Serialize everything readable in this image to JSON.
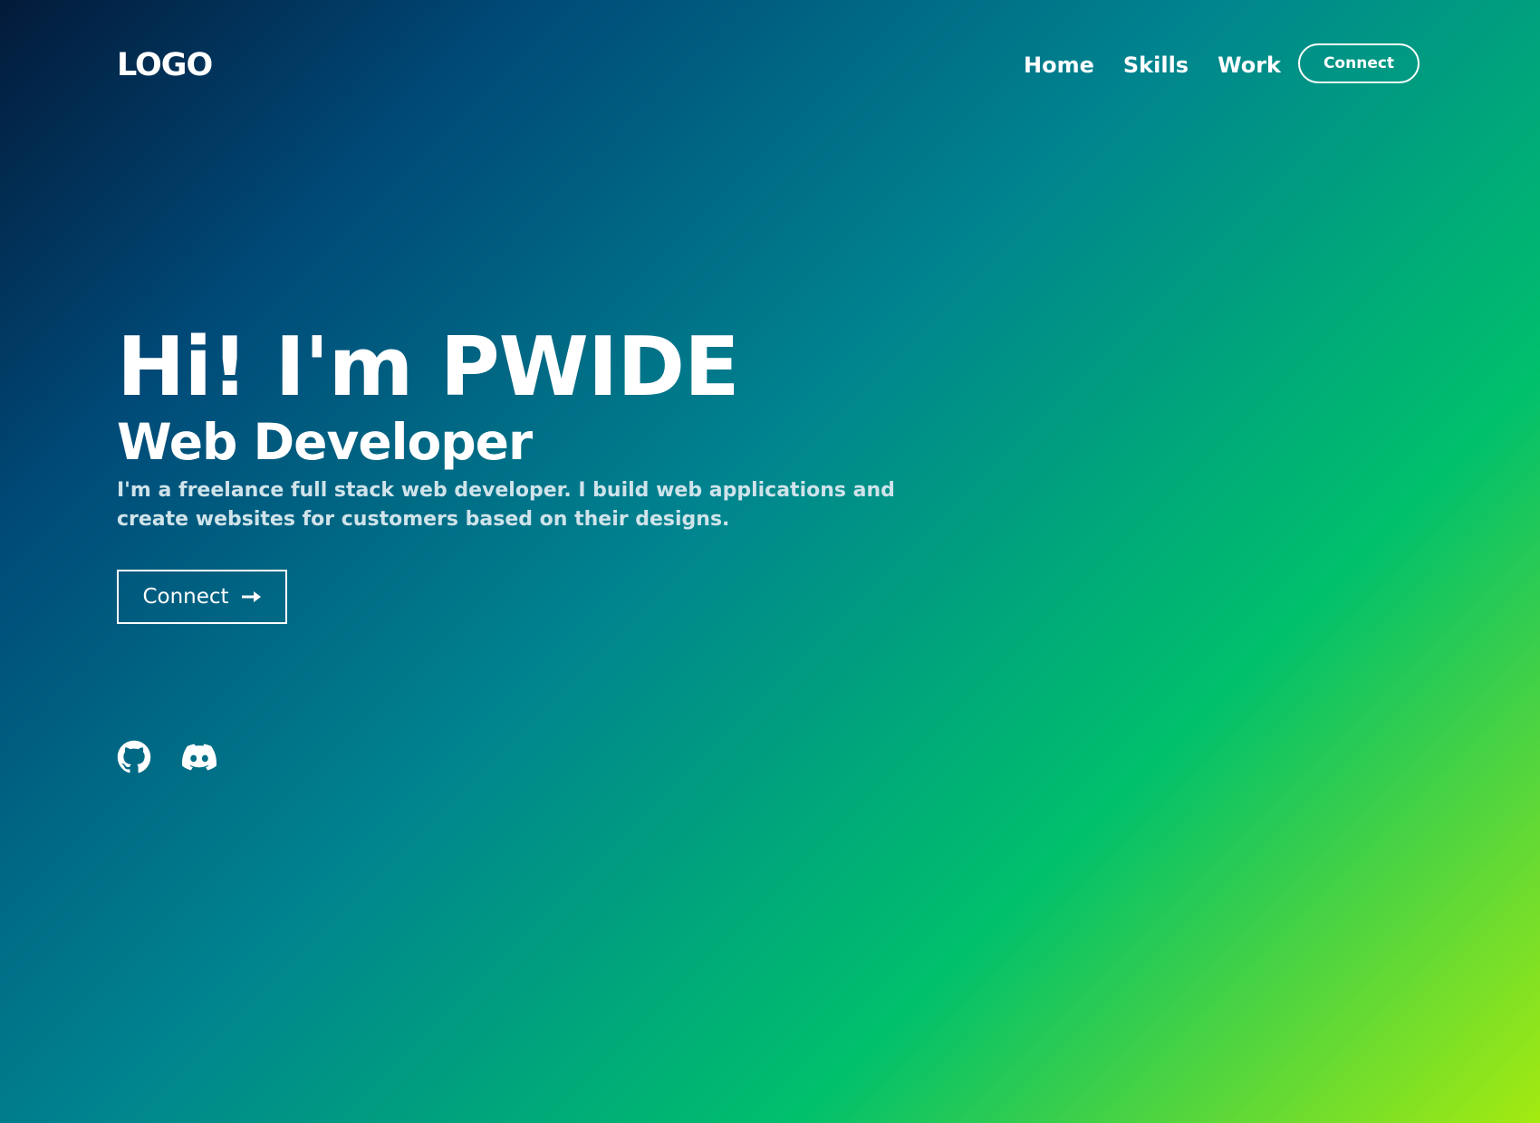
{
  "navbar": {
    "logo": "LOGO",
    "links": [
      {
        "label": "Home"
      },
      {
        "label": "Skills"
      },
      {
        "label": "Work"
      }
    ],
    "connect_label": "Connect"
  },
  "hero": {
    "title": "Hi! I'm PWIDE",
    "subtitle": "Web Developer",
    "description": "I'm a freelance full stack web developer. I build web applications and create websites for customers based on their designs.",
    "connect_label": "Connect",
    "connect_icon": "arrow-right-icon"
  },
  "socials": [
    {
      "icon": "github-icon"
    },
    {
      "icon": "discord-icon"
    }
  ],
  "colors": {
    "gradient_start": "#031a3a",
    "gradient_mid_blue": "#004a78",
    "gradient_teal": "#00838f",
    "gradient_green": "#00c06c",
    "gradient_end": "#a4ea10",
    "text": "#ffffff",
    "description_text": "#cfe3ea"
  }
}
